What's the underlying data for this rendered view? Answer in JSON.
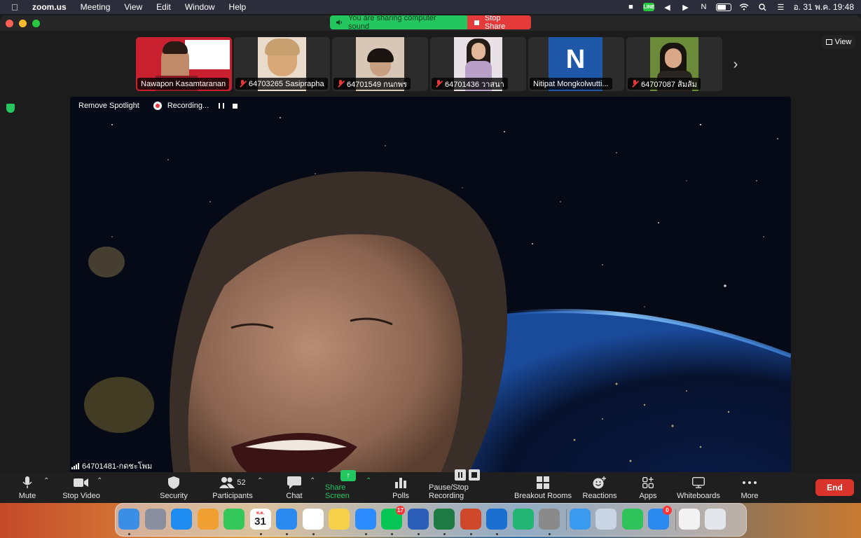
{
  "menubar": {
    "app_name": "zoom.us",
    "menus": [
      "Meeting",
      "View",
      "Edit",
      "Window",
      "Help"
    ],
    "clock": "อ. 31 พ.ค.  19:48",
    "line_icon_text": "LINE",
    "icons": [
      "zoom-icon",
      "line-icon",
      "back-icon",
      "play-circle-icon",
      "notion-icon",
      "battery-icon",
      "wifi-icon",
      "search-icon",
      "control-center-icon"
    ]
  },
  "share_banner": {
    "sound_text": "You are sharing computer sound",
    "stop_label": "Stop Share"
  },
  "view_button": {
    "label": "View"
  },
  "thumbnails": [
    {
      "name": "Nawapon Kasamtaranan",
      "muted": false,
      "bg": "#c8202f"
    },
    {
      "name": "64703265 Sasiprapha",
      "muted": true,
      "bg": "#e9dccd"
    },
    {
      "name": "64701549 กนกพร",
      "muted": true,
      "bg": "#d8c7b6"
    },
    {
      "name": "64701436 วาสนา",
      "muted": true,
      "bg": "#e8e2e6"
    },
    {
      "name": "Nitipat Mongkolwutti...",
      "muted": false,
      "bg": "#1f58a8",
      "initial": "N"
    },
    {
      "name": "64707087 ส้มส้ม",
      "muted": true,
      "bg": "#6b8a3a"
    }
  ],
  "spotlight": {
    "remove_label": "Remove Spotlight",
    "recording_label": "Recording..."
  },
  "speaker": {
    "name": "64701481-กดชะโพม"
  },
  "toolbar": {
    "mute": "Mute",
    "stop_video": "Stop Video",
    "security": "Security",
    "participants": "Participants",
    "participants_count": "52",
    "chat": "Chat",
    "share_screen": "Share Screen",
    "polls": "Polls",
    "recording": "Pause/Stop Recording",
    "breakout": "Breakout Rooms",
    "reactions": "Reactions",
    "apps": "Apps",
    "whiteboards": "Whiteboards",
    "more": "More",
    "end": "End"
  },
  "dock": {
    "calendar_month": "พ.ค.",
    "calendar_day": "31",
    "line_badge": "17",
    "safari_badge": "0",
    "items": [
      {
        "name": "finder",
        "color": "#3a8ee6"
      },
      {
        "name": "launchpad",
        "color": "#8a8fa0"
      },
      {
        "name": "app-store",
        "color": "#1e8cf0"
      },
      {
        "name": "photos",
        "color": "#f0a030"
      },
      {
        "name": "facetime",
        "color": "#34c759"
      },
      {
        "name": "calendar",
        "color": "#ffffff"
      },
      {
        "name": "safari",
        "color": "#2a8af0"
      },
      {
        "name": "chrome",
        "color": "#ffffff"
      },
      {
        "name": "notes",
        "color": "#f7d14a"
      },
      {
        "name": "zoom",
        "color": "#2d8cff"
      },
      {
        "name": "line",
        "color": "#06c755"
      },
      {
        "name": "word",
        "color": "#2b5eb8"
      },
      {
        "name": "excel",
        "color": "#1d7a43"
      },
      {
        "name": "powerpoint",
        "color": "#d0482a"
      },
      {
        "name": "outlook",
        "color": "#1a6fd0"
      },
      {
        "name": "app-green",
        "color": "#22b573"
      },
      {
        "name": "system-preferences",
        "color": "#8a8a8a"
      },
      {
        "name": "mail",
        "color": "#3a9af0"
      },
      {
        "name": "preview",
        "color": "#c9d4e4"
      },
      {
        "name": "numbers",
        "color": "#31c35b"
      },
      {
        "name": "safari-2",
        "color": "#2a8af0"
      },
      {
        "name": "document",
        "color": "#f2f2f2"
      },
      {
        "name": "trash",
        "color": "#e3e6ea"
      }
    ]
  }
}
